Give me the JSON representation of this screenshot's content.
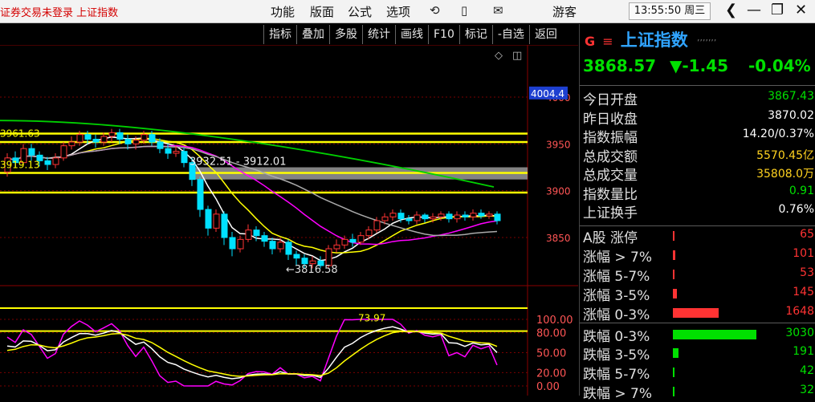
{
  "titlebar": {
    "app_title": "证券交易未登录  上证指数",
    "menu": [
      "功能",
      "版面",
      "公式",
      "选项"
    ],
    "icons": [
      "refresh-icon",
      "phone-icon",
      "mail-icon"
    ],
    "icon_glyphs": [
      "⟲",
      "▯",
      "✉"
    ],
    "guest": "游客",
    "clock": "13:55:50 周三",
    "window_controls": [
      "❮",
      "—",
      "❐",
      "✕"
    ]
  },
  "toolbar": [
    "指标",
    "叠加",
    "多股",
    "统计",
    "画线",
    "F10",
    "标记",
    "-自选",
    "返回"
  ],
  "chart_data": {
    "type": "candlestick",
    "price_axis": {
      "labels": [
        "4000",
        "3950",
        "3900",
        "3850"
      ],
      "values": [
        4000,
        3950,
        3900,
        3850
      ],
      "current_label": "4004.4",
      "current_value": 4004.4
    },
    "indicator_axis": {
      "labels": [
        "100.00",
        "80.00",
        "50.00",
        "20.00",
        "0.00"
      ],
      "values": [
        100,
        80,
        50,
        20,
        0
      ]
    },
    "annotations": {
      "left_high": "3961.63",
      "left_low": "3919.13",
      "range_label": "3932.51 - 3912.01",
      "low_label": "←3816.58",
      "indicator_label": "73.97"
    },
    "horizontal_lines": [
      3961,
      3952,
      3919,
      3898
    ],
    "gap_band": [
      3912,
      3925
    ],
    "candles": [
      [
        3920,
        3935,
        3915,
        3940
      ],
      [
        3935,
        3930,
        3925,
        3942
      ],
      [
        3930,
        3945,
        3928,
        3950
      ],
      [
        3945,
        3938,
        3932,
        3950
      ],
      [
        3938,
        3932,
        3926,
        3942
      ],
      [
        3932,
        3928,
        3922,
        3936
      ],
      [
        3928,
        3935,
        3924,
        3940
      ],
      [
        3935,
        3948,
        3932,
        3952
      ],
      [
        3948,
        3952,
        3944,
        3958
      ],
      [
        3952,
        3960,
        3948,
        3964
      ],
      [
        3960,
        3955,
        3950,
        3964
      ],
      [
        3955,
        3952,
        3946,
        3960
      ],
      [
        3952,
        3958,
        3948,
        3962
      ],
      [
        3958,
        3962,
        3952,
        3966
      ],
      [
        3962,
        3955,
        3950,
        3966
      ],
      [
        3955,
        3950,
        3944,
        3960
      ],
      [
        3950,
        3954,
        3944,
        3958
      ],
      [
        3954,
        3960,
        3950,
        3964
      ],
      [
        3960,
        3952,
        3948,
        3964
      ],
      [
        3952,
        3945,
        3940,
        3956
      ],
      [
        3945,
        3940,
        3934,
        3950
      ],
      [
        3940,
        3942,
        3936,
        3948
      ],
      [
        3942,
        3930,
        3925,
        3946
      ],
      [
        3930,
        3912,
        3905,
        3935
      ],
      [
        3912,
        3880,
        3872,
        3915
      ],
      [
        3880,
        3860,
        3852,
        3884
      ],
      [
        3860,
        3875,
        3856,
        3880
      ],
      [
        3875,
        3850,
        3842,
        3878
      ],
      [
        3850,
        3838,
        3830,
        3856
      ],
      [
        3838,
        3848,
        3834,
        3852
      ],
      [
        3848,
        3858,
        3845,
        3864
      ],
      [
        3858,
        3852,
        3846,
        3862
      ],
      [
        3852,
        3846,
        3840,
        3856
      ],
      [
        3846,
        3838,
        3832,
        3850
      ],
      [
        3838,
        3845,
        3834,
        3850
      ],
      [
        3845,
        3832,
        3826,
        3848
      ],
      [
        3832,
        3828,
        3820,
        3836
      ],
      [
        3828,
        3822,
        3817,
        3832
      ],
      [
        3822,
        3825,
        3817,
        3830
      ],
      [
        3825,
        3820,
        3817,
        3830
      ],
      [
        3820,
        3838,
        3817,
        3842
      ],
      [
        3838,
        3842,
        3834,
        3848
      ],
      [
        3842,
        3848,
        3838,
        3852
      ],
      [
        3848,
        3845,
        3840,
        3854
      ],
      [
        3845,
        3852,
        3842,
        3856
      ],
      [
        3852,
        3858,
        3848,
        3862
      ],
      [
        3858,
        3868,
        3855,
        3872
      ],
      [
        3868,
        3872,
        3864,
        3876
      ],
      [
        3872,
        3876,
        3868,
        3880
      ],
      [
        3876,
        3870,
        3866,
        3880
      ],
      [
        3870,
        3868,
        3864,
        3874
      ],
      [
        3868,
        3874,
        3864,
        3878
      ],
      [
        3874,
        3870,
        3866,
        3876
      ],
      [
        3870,
        3872,
        3866,
        3876
      ],
      [
        3872,
        3875,
        3868,
        3878
      ],
      [
        3875,
        3870,
        3866,
        3878
      ],
      [
        3870,
        3874,
        3866,
        3878
      ],
      [
        3874,
        3872,
        3868,
        3878
      ],
      [
        3872,
        3876,
        3868,
        3880
      ],
      [
        3876,
        3873,
        3870,
        3880
      ],
      [
        3873,
        3875,
        3870,
        3878
      ],
      [
        3875,
        3868,
        3864,
        3878
      ]
    ]
  },
  "panel": {
    "g_label": "G",
    "menu_glyph": "≡",
    "title": "上证指数",
    "subtitle": "ʼʼʼʼʼʼʼ",
    "price": "3868.57",
    "change": "▼-1.45",
    "change_pct": "-0.04%",
    "stats": [
      {
        "label": "今日开盘",
        "value": "3867.43",
        "color": "#00e000"
      },
      {
        "label": "昨日收盘",
        "value": "3870.02",
        "color": "#ffffff"
      },
      {
        "label": "指数振幅",
        "value": "14.20/0.37%",
        "color": "#ffffff"
      },
      {
        "label": "总成交额",
        "value": "5570.45亿",
        "color": "#ffd21f"
      },
      {
        "label": "总成交量",
        "value": "35808.0万",
        "color": "#ffd21f"
      },
      {
        "label": "指数量比",
        "value": "0.91",
        "color": "#00e000"
      },
      {
        "label": "上证换手",
        "value": "0.76%",
        "color": "#ffffff"
      }
    ],
    "breadth": [
      {
        "label": "A股 涨停",
        "value": "65",
        "count": 65,
        "color": "#ff3333"
      },
      {
        "label": "涨幅 > 7%",
        "value": "101",
        "count": 101,
        "color": "#ff3333"
      },
      {
        "label": "涨幅 5-7%",
        "value": "53",
        "count": 53,
        "color": "#ff3333"
      },
      {
        "label": "涨幅 3-5%",
        "value": "145",
        "count": 145,
        "color": "#ff3333"
      },
      {
        "label": "涨幅 0-3%",
        "value": "1648",
        "count": 1648,
        "color": "#ff3333"
      },
      {
        "label": "跌幅 0-3%",
        "value": "3030",
        "count": 3030,
        "color": "#00e000"
      },
      {
        "label": "跌幅 3-5%",
        "value": "191",
        "count": 191,
        "color": "#00e000"
      },
      {
        "label": "跌幅 5-7%",
        "value": "42",
        "count": 42,
        "color": "#00e000"
      },
      {
        "label": "跌幅 > 7%",
        "value": "32",
        "count": 32,
        "color": "#00e000"
      }
    ]
  },
  "colors": {
    "up": "#ff3333",
    "down": "#00e000",
    "accent": "#30a4ff",
    "ma": "#ffff00"
  }
}
